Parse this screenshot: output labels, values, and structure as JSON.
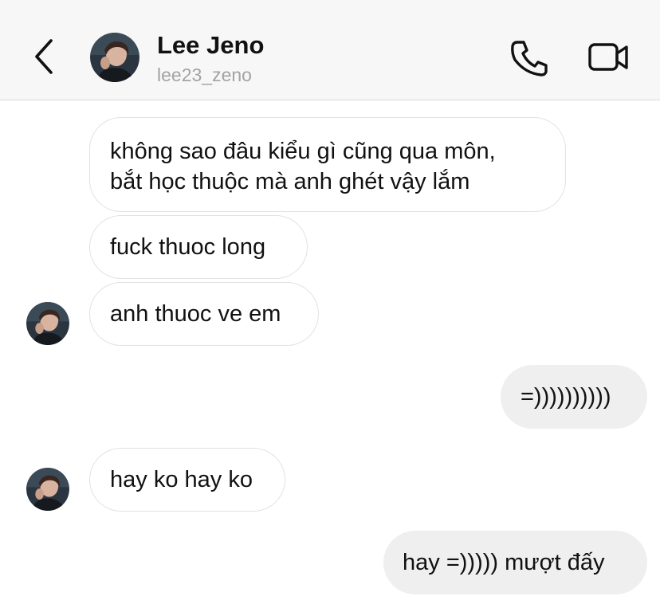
{
  "header": {
    "name": "Lee Jeno",
    "username": "lee23_zeno",
    "icons": {
      "back": "chevron-left-icon",
      "call": "phone-icon",
      "video": "video-camera-icon"
    }
  },
  "messages": [
    {
      "direction": "incoming",
      "lines": [
        "không sao đâu kiểu gì cũng qua môn,",
        "bắt học thuộc mà anh ghét vậy lắm"
      ]
    },
    {
      "direction": "incoming",
      "lines": [
        "fuck thuoc long"
      ]
    },
    {
      "direction": "incoming",
      "lines": [
        "anh thuoc ve em"
      ],
      "show_avatar": true
    },
    {
      "direction": "outgoing",
      "lines": [
        "=))))))))))"
      ]
    },
    {
      "direction": "incoming",
      "lines": [
        "hay ko hay ko"
      ],
      "show_avatar": true
    },
    {
      "direction": "outgoing",
      "lines": [
        "hay =))))) mượt đấy"
      ]
    }
  ],
  "colors": {
    "header_bg": "#f7f7f7",
    "incoming_bubble_bg": "#ffffff",
    "incoming_bubble_border": "#e2e2e2",
    "outgoing_bubble_bg": "#efefef",
    "username_text": "#a3a3a3",
    "text": "#111111"
  }
}
